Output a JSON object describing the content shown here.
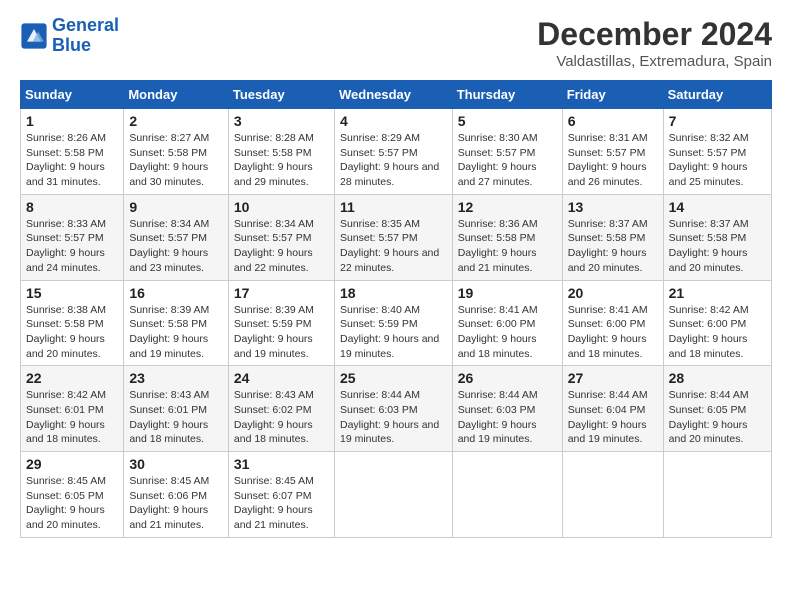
{
  "logo": {
    "line1": "General",
    "line2": "Blue"
  },
  "header": {
    "month": "December 2024",
    "location": "Valdastillas, Extremadura, Spain"
  },
  "weekdays": [
    "Sunday",
    "Monday",
    "Tuesday",
    "Wednesday",
    "Thursday",
    "Friday",
    "Saturday"
  ],
  "weeks": [
    [
      {
        "day": "1",
        "info": "Sunrise: 8:26 AM\nSunset: 5:58 PM\nDaylight: 9 hours and 31 minutes."
      },
      {
        "day": "2",
        "info": "Sunrise: 8:27 AM\nSunset: 5:58 PM\nDaylight: 9 hours and 30 minutes."
      },
      {
        "day": "3",
        "info": "Sunrise: 8:28 AM\nSunset: 5:58 PM\nDaylight: 9 hours and 29 minutes."
      },
      {
        "day": "4",
        "info": "Sunrise: 8:29 AM\nSunset: 5:57 PM\nDaylight: 9 hours and 28 minutes."
      },
      {
        "day": "5",
        "info": "Sunrise: 8:30 AM\nSunset: 5:57 PM\nDaylight: 9 hours and 27 minutes."
      },
      {
        "day": "6",
        "info": "Sunrise: 8:31 AM\nSunset: 5:57 PM\nDaylight: 9 hours and 26 minutes."
      },
      {
        "day": "7",
        "info": "Sunrise: 8:32 AM\nSunset: 5:57 PM\nDaylight: 9 hours and 25 minutes."
      }
    ],
    [
      {
        "day": "8",
        "info": "Sunrise: 8:33 AM\nSunset: 5:57 PM\nDaylight: 9 hours and 24 minutes."
      },
      {
        "day": "9",
        "info": "Sunrise: 8:34 AM\nSunset: 5:57 PM\nDaylight: 9 hours and 23 minutes."
      },
      {
        "day": "10",
        "info": "Sunrise: 8:34 AM\nSunset: 5:57 PM\nDaylight: 9 hours and 22 minutes."
      },
      {
        "day": "11",
        "info": "Sunrise: 8:35 AM\nSunset: 5:57 PM\nDaylight: 9 hours and 22 minutes."
      },
      {
        "day": "12",
        "info": "Sunrise: 8:36 AM\nSunset: 5:58 PM\nDaylight: 9 hours and 21 minutes."
      },
      {
        "day": "13",
        "info": "Sunrise: 8:37 AM\nSunset: 5:58 PM\nDaylight: 9 hours and 20 minutes."
      },
      {
        "day": "14",
        "info": "Sunrise: 8:37 AM\nSunset: 5:58 PM\nDaylight: 9 hours and 20 minutes."
      }
    ],
    [
      {
        "day": "15",
        "info": "Sunrise: 8:38 AM\nSunset: 5:58 PM\nDaylight: 9 hours and 20 minutes."
      },
      {
        "day": "16",
        "info": "Sunrise: 8:39 AM\nSunset: 5:58 PM\nDaylight: 9 hours and 19 minutes."
      },
      {
        "day": "17",
        "info": "Sunrise: 8:39 AM\nSunset: 5:59 PM\nDaylight: 9 hours and 19 minutes."
      },
      {
        "day": "18",
        "info": "Sunrise: 8:40 AM\nSunset: 5:59 PM\nDaylight: 9 hours and 19 minutes."
      },
      {
        "day": "19",
        "info": "Sunrise: 8:41 AM\nSunset: 6:00 PM\nDaylight: 9 hours and 18 minutes."
      },
      {
        "day": "20",
        "info": "Sunrise: 8:41 AM\nSunset: 6:00 PM\nDaylight: 9 hours and 18 minutes."
      },
      {
        "day": "21",
        "info": "Sunrise: 8:42 AM\nSunset: 6:00 PM\nDaylight: 9 hours and 18 minutes."
      }
    ],
    [
      {
        "day": "22",
        "info": "Sunrise: 8:42 AM\nSunset: 6:01 PM\nDaylight: 9 hours and 18 minutes."
      },
      {
        "day": "23",
        "info": "Sunrise: 8:43 AM\nSunset: 6:01 PM\nDaylight: 9 hours and 18 minutes."
      },
      {
        "day": "24",
        "info": "Sunrise: 8:43 AM\nSunset: 6:02 PM\nDaylight: 9 hours and 18 minutes."
      },
      {
        "day": "25",
        "info": "Sunrise: 8:44 AM\nSunset: 6:03 PM\nDaylight: 9 hours and 19 minutes."
      },
      {
        "day": "26",
        "info": "Sunrise: 8:44 AM\nSunset: 6:03 PM\nDaylight: 9 hours and 19 minutes."
      },
      {
        "day": "27",
        "info": "Sunrise: 8:44 AM\nSunset: 6:04 PM\nDaylight: 9 hours and 19 minutes."
      },
      {
        "day": "28",
        "info": "Sunrise: 8:44 AM\nSunset: 6:05 PM\nDaylight: 9 hours and 20 minutes."
      }
    ],
    [
      {
        "day": "29",
        "info": "Sunrise: 8:45 AM\nSunset: 6:05 PM\nDaylight: 9 hours and 20 minutes."
      },
      {
        "day": "30",
        "info": "Sunrise: 8:45 AM\nSunset: 6:06 PM\nDaylight: 9 hours and 21 minutes."
      },
      {
        "day": "31",
        "info": "Sunrise: 8:45 AM\nSunset: 6:07 PM\nDaylight: 9 hours and 21 minutes."
      },
      null,
      null,
      null,
      null
    ]
  ]
}
